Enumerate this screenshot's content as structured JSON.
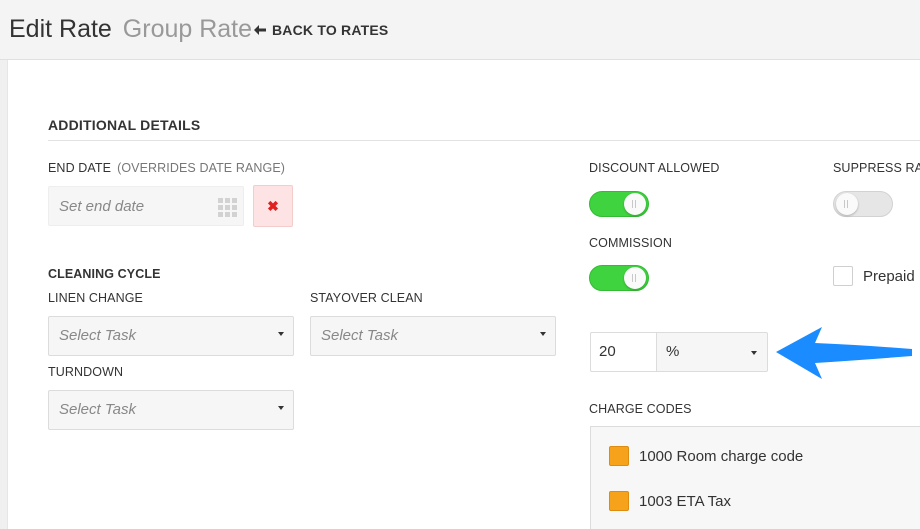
{
  "header": {
    "title": "Edit Rate",
    "subtitle": "Group Rate",
    "back_label": "BACK TO RATES"
  },
  "section": {
    "title": "ADDITIONAL DETAILS"
  },
  "end_date": {
    "label": "END DATE",
    "note": "(OVERRIDES DATE RANGE)",
    "placeholder": "Set end date",
    "clear_glyph": "✖"
  },
  "cleaning_cycle": {
    "title": "CLEANING CYCLE",
    "linen_change": {
      "label": "LINEN CHANGE",
      "placeholder": "Select Task"
    },
    "stayover_clean": {
      "label": "STAYOVER CLEAN",
      "placeholder": "Select Task"
    },
    "turndown": {
      "label": "TURNDOWN",
      "placeholder": "Select Task"
    }
  },
  "discount_allowed": {
    "label": "DISCOUNT ALLOWED",
    "enabled": true
  },
  "suppress_rate": {
    "label": "SUPPRESS RAT",
    "enabled": false
  },
  "commission": {
    "label": "COMMISSION",
    "enabled": true,
    "value": "20",
    "unit": "%"
  },
  "prepaid": {
    "label": "Prepaid",
    "checked": false
  },
  "charge_codes": {
    "label": "CHARGE CODES",
    "items": [
      {
        "label": "1000 Room charge code"
      },
      {
        "label": "1003 ETA Tax"
      }
    ]
  },
  "colors": {
    "toggle_on": "#3fd43f",
    "accent_arrow": "#1a8cff",
    "charge_code_swatch": "#f7a21b",
    "clear_button_bg": "#fde3e3",
    "clear_icon": "#e02020"
  },
  "icons": {
    "back": "arrow-left-icon",
    "calendar": "calendar-grid-icon",
    "clear": "close-icon",
    "dropdown": "caret-down-icon",
    "annotation": "blue-arrow-icon"
  }
}
